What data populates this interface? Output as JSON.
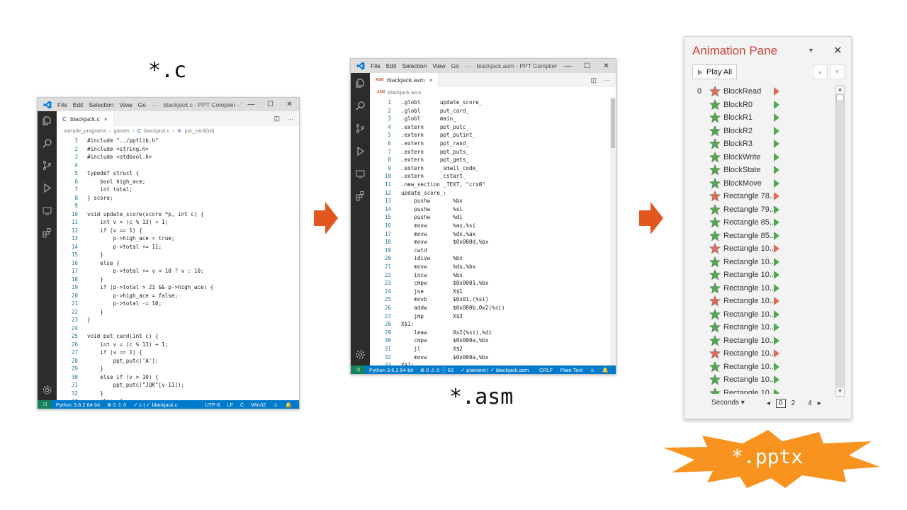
{
  "labels": {
    "c": "*.c",
    "asm": "*.asm",
    "pptx": "*.pptx"
  },
  "colors": {
    "vscode_blue": "#007acc",
    "activity": "#2c2c2c",
    "arrow": "#e2571e",
    "burst": "#f7931e",
    "pane_title": "#c74634",
    "green": "#51a84f",
    "red": "#e06a5c"
  },
  "vscode_c": {
    "menu": [
      "File",
      "Edit",
      "Selection",
      "View",
      "Go",
      "···"
    ],
    "window_title": "blackjack.c - PPT Compiler - Vi...",
    "tab": {
      "type": "C",
      "name": "blackjack.c",
      "close": "×"
    },
    "breadcrumb": [
      "sample_programs",
      "›",
      "games",
      "›",
      "C",
      "blackjack.c",
      "›",
      "⊕",
      "put_card(int)"
    ],
    "lines": [
      {
        "n": "1",
        "t": "#include \"../pptlib.h\""
      },
      {
        "n": "2",
        "t": "#include <string.h>"
      },
      {
        "n": "3",
        "t": "#include <stdbool.h>"
      },
      {
        "n": "4",
        "t": ""
      },
      {
        "n": "5",
        "t": "typedef struct {"
      },
      {
        "n": "6",
        "t": "    bool high_ace;"
      },
      {
        "n": "7",
        "t": "    int total;"
      },
      {
        "n": "8",
        "t": "} score;"
      },
      {
        "n": "9",
        "t": ""
      },
      {
        "n": "10",
        "t": "void update_score(score *p, int c) {"
      },
      {
        "n": "11",
        "t": "    int v = (c % 13) + 1;"
      },
      {
        "n": "12",
        "t": "    if (v == 1) {"
      },
      {
        "n": "13",
        "t": "        p->high_ace = true;"
      },
      {
        "n": "14",
        "t": "        p->total += 11;"
      },
      {
        "n": "15",
        "t": "    }"
      },
      {
        "n": "16",
        "t": "    else {"
      },
      {
        "n": "17",
        "t": "        p->total += v < 10 ? v : 10;"
      },
      {
        "n": "18",
        "t": "    }"
      },
      {
        "n": "19",
        "t": "    if (p->total > 21 && p->high_ace) {"
      },
      {
        "n": "20",
        "t": "        p->high_ace = false;"
      },
      {
        "n": "21",
        "t": "        p->total -= 10;"
      },
      {
        "n": "22",
        "t": "    }"
      },
      {
        "n": "23",
        "t": "}"
      },
      {
        "n": "24",
        "t": ""
      },
      {
        "n": "25",
        "t": "void put_card(int c) {"
      },
      {
        "n": "26",
        "t": "    int v = (c % 13) + 1;"
      },
      {
        "n": "27",
        "t": "    if (v == 1) {"
      },
      {
        "n": "28",
        "t": "        ppt_putc('A');"
      },
      {
        "n": "29",
        "t": "    }"
      },
      {
        "n": "30",
        "t": "    else if (v > 10) {"
      },
      {
        "n": "31",
        "t": "        ppt_putc(\"JQK\"[v-11]);"
      },
      {
        "n": "32",
        "t": "    }"
      },
      {
        "n": "33",
        "t": "    else  {"
      }
    ],
    "status": [
      "Python 3.6.2 64-bit",
      "⊗ 0 ⚠ 0",
      "✓ c | ✓ blackjack.c"
    ],
    "status_right": [
      "UTF-8",
      "LF",
      "C",
      "Win32",
      "☺",
      "🔔"
    ]
  },
  "vscode_asm": {
    "menu": [
      "File",
      "Edit",
      "Selection",
      "View",
      "Go",
      "···"
    ],
    "window_title": "blackjack.asm - PPT Compiler - ...",
    "tab": {
      "type": "ASM",
      "name": "blackjack.asm",
      "close": "×"
    },
    "breadcrumb": [
      "ASM",
      "blackjack.asm"
    ],
    "lines": [
      {
        "n": "1",
        "t": ".globl      update_score_"
      },
      {
        "n": "2",
        "t": ".globl      put_card_"
      },
      {
        "n": "3",
        "t": ".globl      main_"
      },
      {
        "n": "4",
        "t": ".extern     ppt_putc_"
      },
      {
        "n": "5",
        "t": ".extern     ppt_putint_"
      },
      {
        "n": "6",
        "t": ".extern     ppt_rand_"
      },
      {
        "n": "7",
        "t": ".extern     ppt_puts_"
      },
      {
        "n": "8",
        "t": ".extern     ppt_gets_"
      },
      {
        "n": "9",
        "t": ".extern     _small_code_"
      },
      {
        "n": "10",
        "t": ".extern     _cstart_"
      },
      {
        "n": "11",
        "t": ".new_section _TEXT, \"crx0\""
      },
      {
        "n": "12",
        "t": "update_score_:"
      },
      {
        "n": "13",
        "t": "    pushw       %bx"
      },
      {
        "n": "14",
        "t": "    pushw       %si"
      },
      {
        "n": "15",
        "t": "    pushw       %di"
      },
      {
        "n": "16",
        "t": "    movw        %ax,%si"
      },
      {
        "n": "17",
        "t": "    movw        %dx,%ax"
      },
      {
        "n": "18",
        "t": "    movw        $0x000d,%bx"
      },
      {
        "n": "19",
        "t": "    cwtd"
      },
      {
        "n": "20",
        "t": "    idivw       %bx"
      },
      {
        "n": "21",
        "t": "    movw        %dx,%bx"
      },
      {
        "n": "22",
        "t": "    incw        %bx"
      },
      {
        "n": "23",
        "t": "    cmpw        $0x0001,%bx"
      },
      {
        "n": "24",
        "t": "    jne         X$1"
      },
      {
        "n": "25",
        "t": "    movb        $0x01,(%si)"
      },
      {
        "n": "26",
        "t": "    addw        $0x000b,0x2(%si)"
      },
      {
        "n": "27",
        "t": "    jmp         X$3"
      },
      {
        "n": "28",
        "t": "X$1:"
      },
      {
        "n": "29",
        "t": "    leaw        0x2(%si),%di"
      },
      {
        "n": "30",
        "t": "    cmpw        $0x000a,%bx"
      },
      {
        "n": "31",
        "t": "    jl          X$2"
      },
      {
        "n": "32",
        "t": "    movw        $0x000a,%bx"
      },
      {
        "n": "33",
        "t": "X$2:"
      }
    ],
    "status": [
      "Python 3.6.2 64-bit",
      "⊗ 0 ⚠ 0 ⓘ 63",
      "✓ plaintext | ✓ blackjack.asm"
    ],
    "status_right": [
      "CRLF",
      "Plain Text",
      "☺",
      "🔔"
    ]
  },
  "animation_pane": {
    "title": "Animation Pane",
    "dropdown": "▾",
    "close": "✕",
    "play_all": "Play All",
    "move_up": "▲",
    "move_down": "▼",
    "first_number": "0",
    "items": [
      {
        "name": "BlockRead",
        "effect": "exit"
      },
      {
        "name": "BlockR0",
        "effect": "entrance"
      },
      {
        "name": "BlockR1",
        "effect": "entrance"
      },
      {
        "name": "BlockR2",
        "effect": "entrance"
      },
      {
        "name": "BlockR3",
        "effect": "entrance"
      },
      {
        "name": "BlockWrite",
        "effect": "entrance"
      },
      {
        "name": "BlockState",
        "effect": "entrance"
      },
      {
        "name": "BlockMove",
        "effect": "entrance"
      },
      {
        "name": "Rectangle 78...",
        "effect": "exit"
      },
      {
        "name": "Rectangle 79...",
        "effect": "entrance"
      },
      {
        "name": "Rectangle 85...",
        "effect": "entrance"
      },
      {
        "name": "Rectangle 85...",
        "effect": "entrance"
      },
      {
        "name": "Rectangle 10...",
        "effect": "exit"
      },
      {
        "name": "Rectangle 10...",
        "effect": "entrance"
      },
      {
        "name": "Rectangle 10...",
        "effect": "entrance"
      },
      {
        "name": "Rectangle 10...",
        "effect": "entrance"
      },
      {
        "name": "Rectangle 10...",
        "effect": "exit"
      },
      {
        "name": "Rectangle 10...",
        "effect": "entrance"
      },
      {
        "name": "Rectangle 10...",
        "effect": "entrance"
      },
      {
        "name": "Rectangle 10...",
        "effect": "entrance"
      },
      {
        "name": "Rectangle 10...",
        "effect": "exit"
      },
      {
        "name": "Rectangle 10...",
        "effect": "entrance"
      },
      {
        "name": "Rectangle 10...",
        "effect": "entrance"
      },
      {
        "name": "Rectangle 10...",
        "effect": "entrance"
      }
    ],
    "seconds_label": "Seconds ▾",
    "scale": [
      "◂",
      "0",
      "2",
      "4",
      "▸"
    ]
  }
}
